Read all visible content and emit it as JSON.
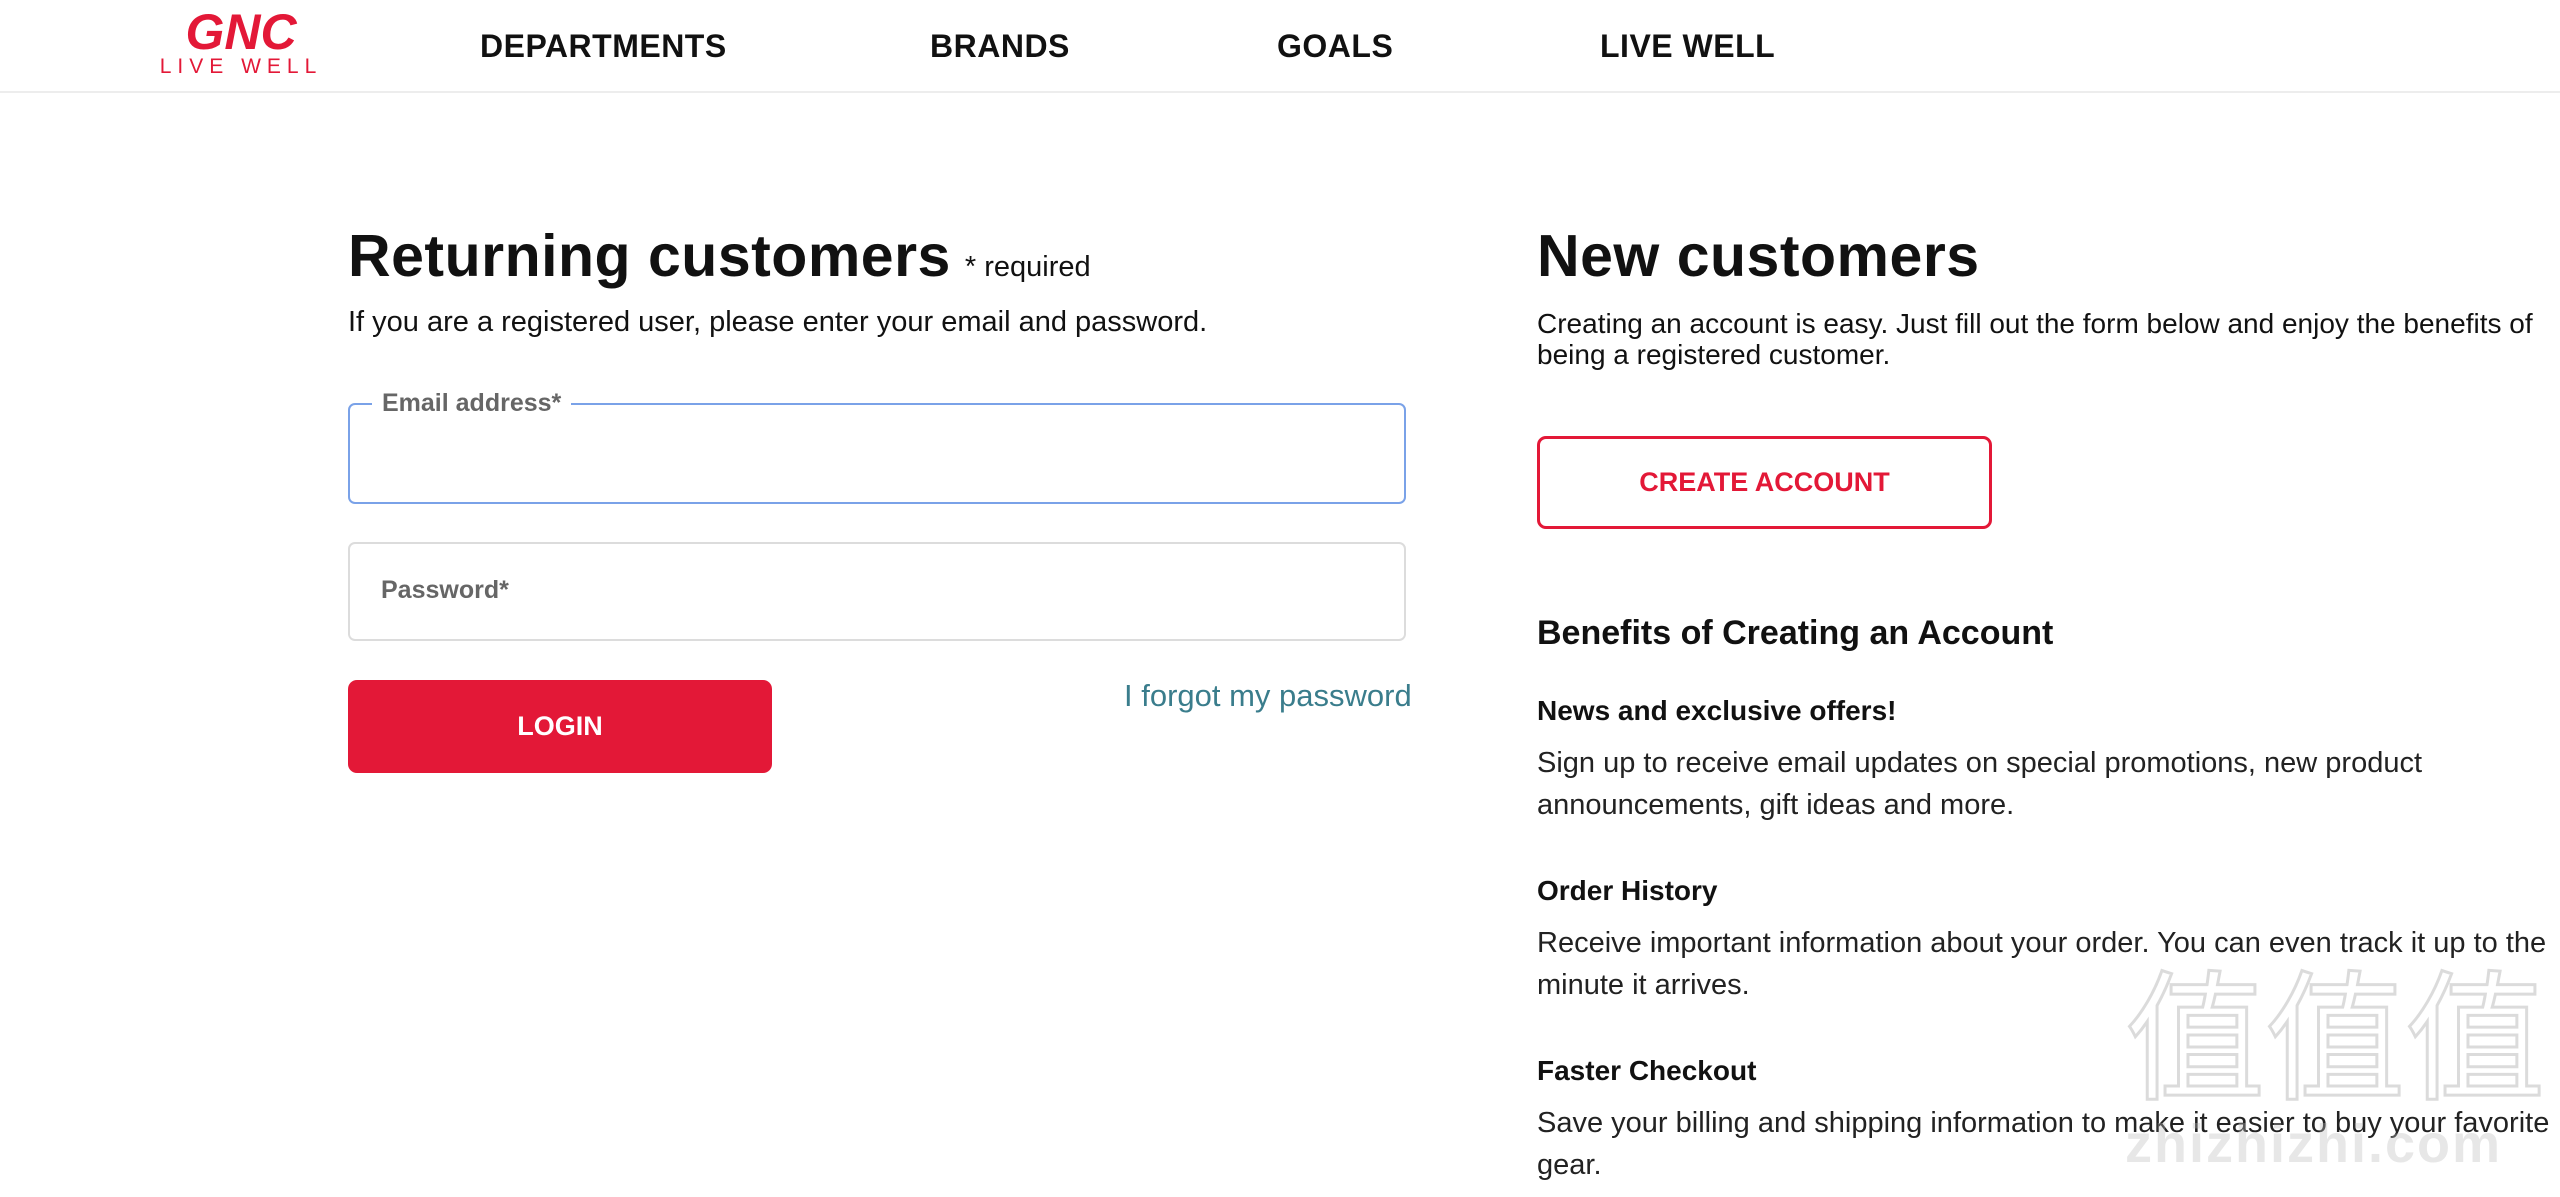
{
  "brand": {
    "name": "GNC",
    "tagline": "LIVE WELL",
    "color": "#e31837"
  },
  "nav": {
    "items": [
      {
        "label": "DEPARTMENTS"
      },
      {
        "label": "BRANDS"
      },
      {
        "label": "GOALS"
      },
      {
        "label": "LIVE WELL"
      }
    ]
  },
  "returning": {
    "title": "Returning customers",
    "required_note": "* required",
    "intro": "If you are a registered user, please enter your email and password.",
    "email_label": "Email address*",
    "email_value": "",
    "password_label": "Password*",
    "password_value": "",
    "login_label": "LOGIN",
    "forgot_label": "I forgot my password"
  },
  "new_customers": {
    "title": "New customers",
    "intro": "Creating an account is easy. Just fill out the form below and enjoy the benefits of being a registered customer.",
    "create_label": "CREATE ACCOUNT",
    "benefits_title": "Benefits of Creating an Account",
    "benefits": [
      {
        "heading": "News and exclusive offers!",
        "text": "Sign up to receive email updates on special promotions, new product announcements, gift ideas and more."
      },
      {
        "heading": "Order History",
        "text": "Receive important information about your order. You can even track it up to the minute it arrives."
      },
      {
        "heading": "Faster Checkout",
        "text": "Save your billing and shipping information to make it easier to buy your favorite gear."
      }
    ]
  },
  "watermark": {
    "glyphs": "值值值",
    "text": "zhizhizhi.com"
  },
  "colors": {
    "accent": "#e31837",
    "link": "#3a7d8c",
    "focus_border": "#7aa2e8"
  }
}
